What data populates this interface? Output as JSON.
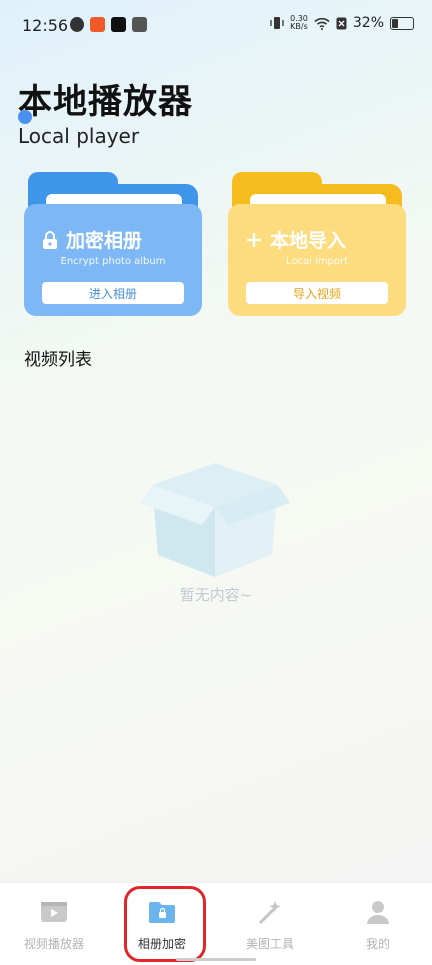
{
  "status_bar": {
    "time": "12:56",
    "net_speed_value": "0.30",
    "net_speed_unit": "KB/s",
    "battery": "32%"
  },
  "header": {
    "title_cn": "本地播放器",
    "title_en": "Local player"
  },
  "cards": [
    {
      "title": "加密相册",
      "subtitle": "Encrypt photo album",
      "button": "进入相册",
      "icon": "lock-icon",
      "color": "#7db7f5"
    },
    {
      "title": "本地导入",
      "subtitle": "Local import",
      "button": "导入视频",
      "icon": "plus-icon",
      "color": "#fddc80"
    }
  ],
  "section_title": "视频列表",
  "empty_text": "暂无内容~",
  "nav": [
    {
      "label": "视频播放器",
      "icon": "video-player-icon"
    },
    {
      "label": "相册加密",
      "icon": "encrypted-folder-icon",
      "active": true
    },
    {
      "label": "美图工具",
      "icon": "magic-wand-icon"
    },
    {
      "label": "我的",
      "icon": "user-icon"
    }
  ],
  "colors": {
    "accent_blue": "#3f95ea",
    "accent_yellow": "#f6bb1c",
    "highlight_red": "#e0262a"
  }
}
